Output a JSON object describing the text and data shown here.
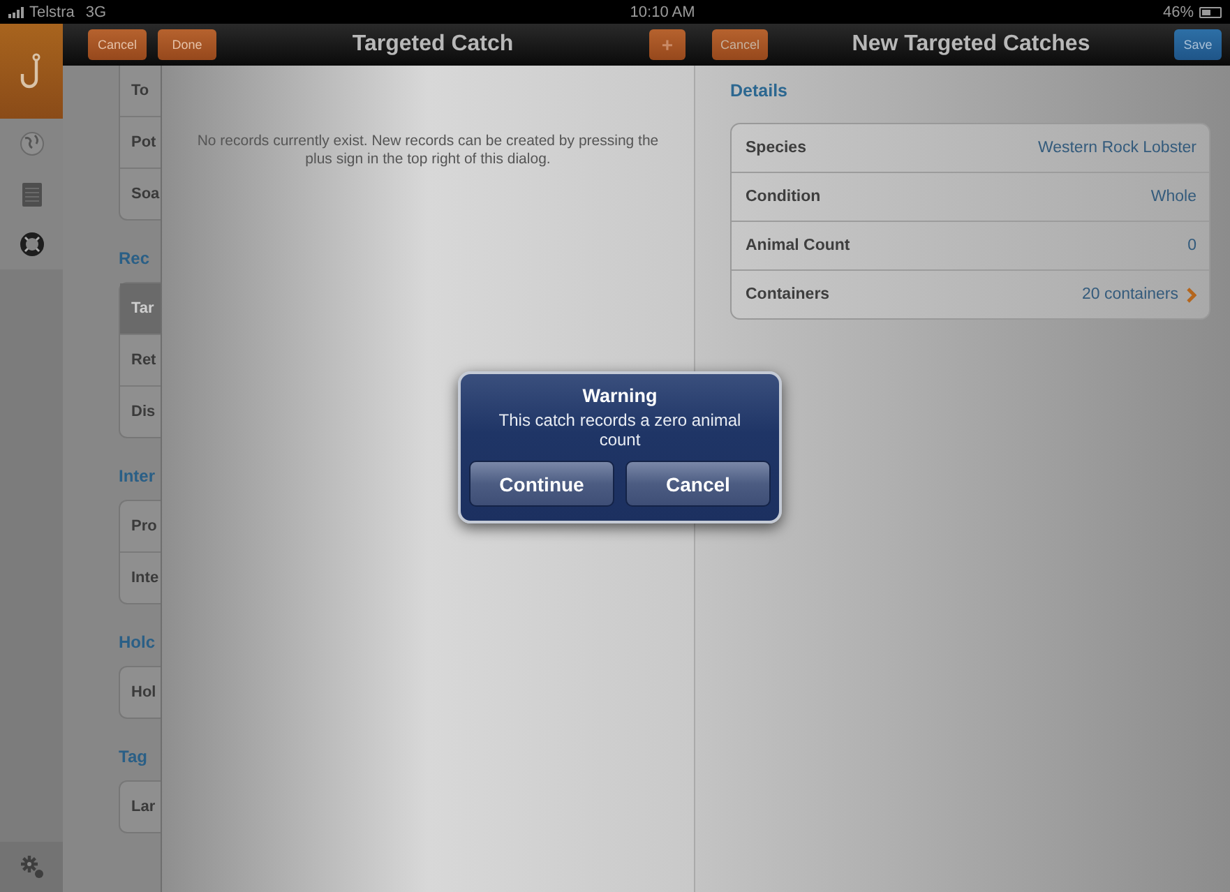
{
  "status_bar": {
    "carrier": "Telstra",
    "network": "3G",
    "time": "10:10 AM",
    "battery": "46%"
  },
  "sidebar": {
    "items": [
      {
        "kind": "hook",
        "selected": true
      },
      {
        "kind": "globe",
        "selected": false
      },
      {
        "kind": "list",
        "selected": false
      },
      {
        "kind": "lifebuoy",
        "selected": false
      }
    ],
    "settings": {
      "kind": "gear"
    }
  },
  "record_list": {
    "sections": [
      {
        "items": [
          {
            "label": "To",
            "selected": false
          },
          {
            "label": "Pot",
            "selected": false
          },
          {
            "label": "Soa",
            "selected": false
          }
        ]
      },
      {
        "heading": "Rec",
        "items": [
          {
            "label": "Tar",
            "selected": true
          },
          {
            "label": "Ret",
            "selected": false
          },
          {
            "label": "Dis",
            "selected": false
          }
        ]
      },
      {
        "heading": "Inter",
        "items": [
          {
            "label": "Pro",
            "selected": false
          },
          {
            "label": "Inte",
            "selected": false
          }
        ]
      },
      {
        "heading": "Holc",
        "items": [
          {
            "label": "Hol",
            "selected": false
          }
        ]
      },
      {
        "heading": "Tag",
        "items": [
          {
            "label": "Lar",
            "selected": false
          }
        ]
      }
    ]
  },
  "targeted_catch": {
    "title": "Targeted Catch",
    "cancel": "Cancel",
    "done": "Done",
    "add": "+",
    "empty_message": "No records currently exist. New records can be created by pressing the plus sign in the top right of this dialog."
  },
  "new_targeted_catches": {
    "title": "New Targeted Catches",
    "cancel": "Cancel",
    "save": "Save",
    "section": "Details",
    "rows": [
      {
        "label": "Species",
        "value": "Western Rock Lobster",
        "kind": "plain"
      },
      {
        "label": "Condition",
        "value": "Whole",
        "kind": "plain"
      },
      {
        "label": "Animal Count",
        "value": "0",
        "kind": "plain"
      },
      {
        "label": "Containers",
        "value": "20 containers",
        "kind": "disclosure"
      }
    ]
  },
  "alert": {
    "title": "Warning",
    "message": "This catch records a zero animal count",
    "buttons": [
      "Continue",
      "Cancel"
    ]
  }
}
